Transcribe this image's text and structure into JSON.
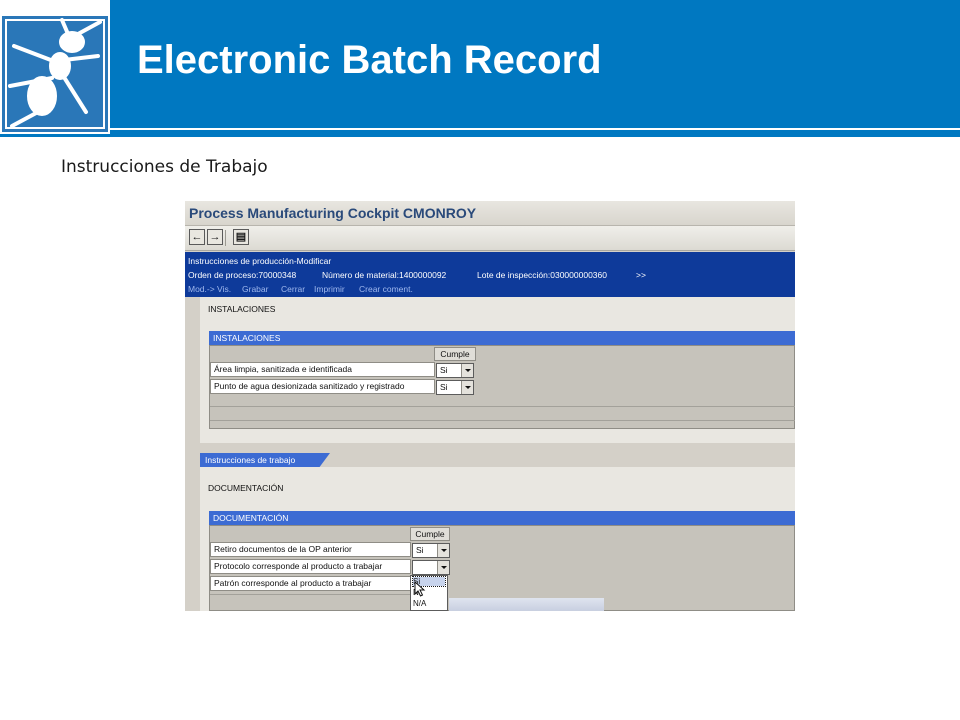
{
  "slide": {
    "title": "Electronic Batch Record",
    "subtitle": "Instrucciones de Trabajo",
    "logo_icon": "ant-logo-icon",
    "colors": {
      "header_blue": "#0078c1",
      "sap_header_blue": "#0e3a9a",
      "section_blue": "#3c6bd3"
    }
  },
  "sap": {
    "window_title": "Process Manufacturing Cockpit CMONROY",
    "toolbar": {
      "back_icon": "arrow-left-icon",
      "forward_icon": "arrow-right-icon",
      "overview_icon": "overview-icon"
    },
    "header": {
      "title": "Instrucciones de producción-Modificar",
      "order": "Orden de proceso:70000348",
      "material": "Número de material:1400000092",
      "lot": "Lote de inspección:030000000360",
      "more": ">>",
      "actions": [
        "Mod.-> Vis.",
        "Grabar",
        "Cerrar",
        "Imprimir",
        "Crear coment."
      ]
    },
    "installations": {
      "label": "INSTALACIONES",
      "section_title": "INSTALACIONES",
      "column_header": "Cumple",
      "rows": [
        {
          "item": "Área limpia, sanitizada e identificada",
          "value": "Si"
        },
        {
          "item": "Punto de agua desionizada sanitizado y registrado",
          "value": "Si"
        }
      ]
    },
    "work_instructions": {
      "tab_label": "Instrucciones de trabajo",
      "label": "DOCUMENTACIÓN",
      "section_title": "DOCUMENTACIÓN",
      "column_header": "Cumple",
      "rows": [
        {
          "item": "Retiro documentos de la OP anterior",
          "value": "Si"
        },
        {
          "item": "Protocolo corresponde al producto a trabajar",
          "value": ""
        },
        {
          "item": "Patrón corresponde al producto a trabajar",
          "value": ""
        }
      ],
      "dropdown_options": [
        "Si",
        "N",
        "N/A"
      ]
    }
  }
}
